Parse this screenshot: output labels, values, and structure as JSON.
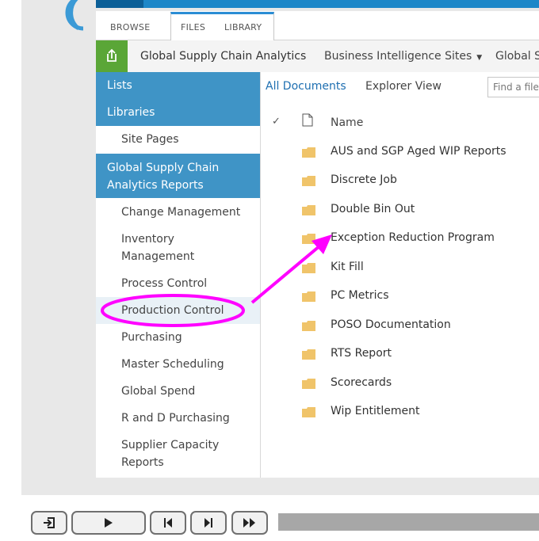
{
  "ribbon": {
    "tabs": [
      "BROWSE",
      "FILES",
      "LIBRARY"
    ]
  },
  "breadcrumbs": [
    "Global Supply Chain Analytics",
    "Business Intelligence Sites",
    "Global S"
  ],
  "nav": {
    "lists": "Lists",
    "libraries": "Libraries",
    "site_pages": "Site Pages",
    "section": [
      "Global Supply Chain",
      "Analytics Reports"
    ],
    "items": [
      [
        "Change Management"
      ],
      [
        "Inventory",
        "Management"
      ],
      [
        "Process Control"
      ],
      [
        "Production Control"
      ],
      [
        "Purchasing"
      ],
      [
        "Master Scheduling"
      ],
      [
        "Global Spend"
      ],
      [
        "R and D Purchasing"
      ],
      [
        "Supplier Capacity",
        "Reports"
      ]
    ],
    "highlighted": "Production Control"
  },
  "views": {
    "all": "All Documents",
    "explorer": "Explorer View",
    "find_placeholder": "Find a file"
  },
  "list": {
    "check": "✓",
    "name_header": "Name",
    "folders": [
      "AUS and SGP Aged WIP Reports",
      "Discrete Job",
      "Double Bin Out",
      "Exception Reduction Program",
      "Kit Fill",
      "PC Metrics",
      "POSO Documentation",
      "RTS Report",
      "Scorecards",
      "Wip Entitlement"
    ]
  },
  "colors": {
    "nav_header": "#3f94c6",
    "link": "#1e6fb1",
    "folder": "#f0c46a",
    "annotation": "#ff00ff",
    "share": "#5aa637"
  },
  "player": {
    "buttons": [
      "exit-icon",
      "play-icon",
      "skip-back-icon",
      "skip-forward-icon",
      "fast-forward-icon"
    ]
  }
}
